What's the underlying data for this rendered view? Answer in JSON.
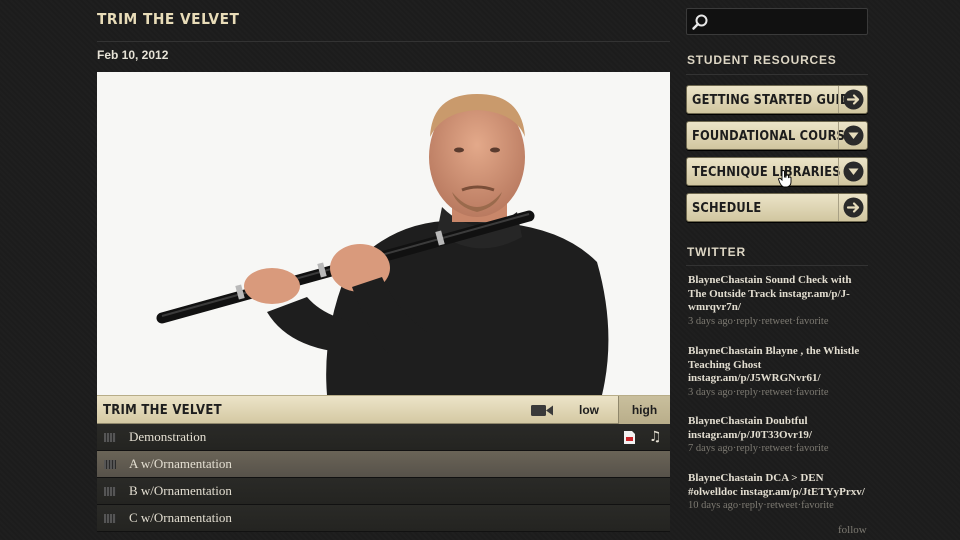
{
  "page": {
    "title": "TRIM THE VELVET",
    "date": "Feb 10, 2012"
  },
  "player": {
    "title": "TRIM THE VELVET",
    "quality_low": "low",
    "quality_high": "high"
  },
  "tracks": [
    {
      "label": "Demonstration"
    },
    {
      "label": "A w/Ornamentation"
    },
    {
      "label": "B w/Ornamentation"
    },
    {
      "label": "C w/Ornamentation"
    }
  ],
  "sidebar": {
    "search_placeholder": "",
    "resources_heading": "STUDENT RESOURCES",
    "resources": [
      {
        "label": "GETTING STARTED GUIDE",
        "icon": "arrow-right-icon"
      },
      {
        "label": "FOUNDATIONAL COURSES",
        "icon": "arrow-down-icon"
      },
      {
        "label": "TECHNIQUE LIBRARIES",
        "icon": "arrow-down-icon"
      },
      {
        "label": "SCHEDULE",
        "icon": "arrow-right-icon"
      }
    ],
    "twitter_heading": "TWITTER",
    "tweets": [
      {
        "text": "BlayneChastain Sound Check with The Outside Track instagr.am/p/J-wmrqvr7n/",
        "meta": "3 days ago·reply·retweet·favorite"
      },
      {
        "text": "BlayneChastain Blayne , the Whistle Teaching Ghost instagr.am/p/J5WRGNvr61/",
        "meta": "3 days ago·reply·retweet·favorite"
      },
      {
        "text": "BlayneChastain Doubtful instagr.am/p/J0T33Ovr19/",
        "meta": "7 days ago·reply·retweet·favorite"
      },
      {
        "text": "BlayneChastain DCA > DEN #olwelldoc instagr.am/p/JtETYyPrxv/",
        "meta": "10 days ago·reply·retweet·favorite"
      }
    ],
    "follow_label": "follow"
  },
  "colors": {
    "background": "#1c1c1c",
    "button_cream": "#e6dcbc",
    "accent_text": "#e8dcb8"
  }
}
